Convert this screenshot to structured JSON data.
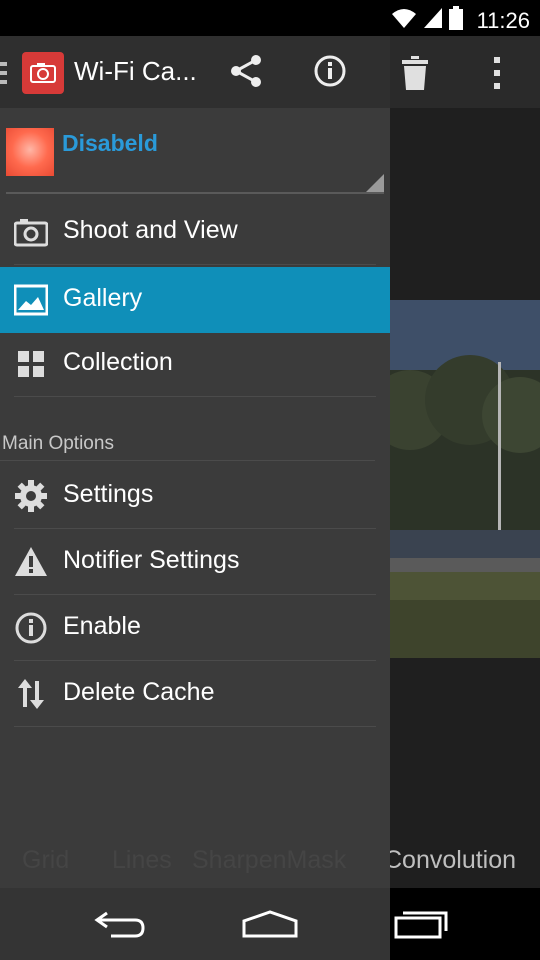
{
  "status": {
    "time": "11:26",
    "icons": [
      "wifi-icon",
      "signal-icon",
      "battery-icon"
    ]
  },
  "header": {
    "title": "Wi-Fi Ca...",
    "icons": [
      "menu-icon",
      "camera-app-icon",
      "share-icon",
      "info-icon",
      "trash-icon",
      "overflow-icon"
    ]
  },
  "account": {
    "name": "Disabeld"
  },
  "menu": {
    "items": [
      {
        "label": "Shoot and View",
        "icon": "camera-icon"
      },
      {
        "label": "Gallery",
        "icon": "image-icon"
      },
      {
        "label": "Collection",
        "icon": "grid-icon"
      }
    ],
    "section_label": "Main Options",
    "options": [
      {
        "label": "Settings",
        "icon": "gear-icon"
      },
      {
        "label": "Notifier Settings",
        "icon": "warning-icon"
      },
      {
        "label": "Enable",
        "icon": "info-circle-icon"
      },
      {
        "label": "Delete Cache",
        "icon": "transfer-icon"
      }
    ]
  },
  "background_tabs": [
    "Grid",
    "Lines",
    "SharpenMask",
    "Convolution"
  ],
  "colors": {
    "accent": "#0f8fb9",
    "account_name": "#2a9ad9",
    "app_icon": "#d73a38"
  },
  "nav": {
    "icons": [
      "back-icon",
      "home-icon",
      "recents-icon"
    ]
  }
}
